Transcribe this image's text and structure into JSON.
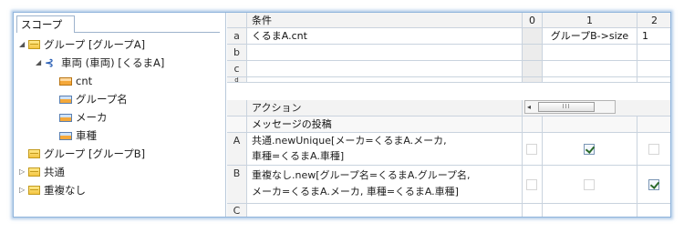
{
  "scope": {
    "tab_label": "スコープ",
    "tree": [
      {
        "label": "グループ [グループA]",
        "expander": "◢",
        "icon": "folder"
      },
      {
        "label": "車両 (車両) [くるまA]",
        "expander": "◢",
        "icon": "association"
      },
      {
        "label": "cnt",
        "expander": "",
        "icon": "field"
      },
      {
        "label": "グループ名",
        "expander": "",
        "icon": "field-blue"
      },
      {
        "label": "メーカ",
        "expander": "",
        "icon": "field-blue"
      },
      {
        "label": "車種",
        "expander": "",
        "icon": "field-blue"
      },
      {
        "label": "グループ [グループB]",
        "expander": "",
        "icon": "folder"
      },
      {
        "label": "共通",
        "expander": "▷",
        "icon": "folder"
      },
      {
        "label": "重複なし",
        "expander": "▷",
        "icon": "folder"
      }
    ]
  },
  "conditions": {
    "header": "条件",
    "columns": [
      "0",
      "1",
      "2"
    ],
    "rows": [
      {
        "id": "a",
        "text": "くるまA.cnt",
        "c1": "グループB->size",
        "c2": "1"
      },
      {
        "id": "b",
        "text": "",
        "c1": "",
        "c2": ""
      },
      {
        "id": "c",
        "text": "",
        "c1": "",
        "c2": ""
      },
      {
        "id": "d",
        "text": "",
        "c1": "",
        "c2": ""
      }
    ]
  },
  "actions": {
    "header": "アクション",
    "subheader": "メッセージの投稿",
    "rows": [
      {
        "id": "A",
        "line1": "共通.newUnique[メーカ=くるまA.メーカ,",
        "line2": "車種=くるまA.車種]",
        "checked": [
          false,
          true,
          false
        ]
      },
      {
        "id": "B",
        "line1": "重複なし.new[グループ名=くるまA.グループ名,",
        "line2": "メーカ=くるまA.メーカ, 車種=くるまA.車種]",
        "checked": [
          false,
          false,
          true
        ]
      },
      {
        "id": "C",
        "line1": "",
        "line2": "",
        "checked": [
          false,
          false,
          false
        ]
      }
    ]
  },
  "scrollbar": {
    "left_arrow": "◂",
    "thumb_grip": "III"
  }
}
